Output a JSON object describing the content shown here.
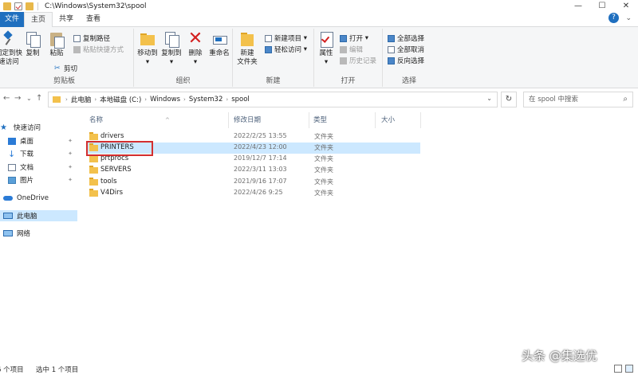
{
  "window": {
    "title": "C:\\Windows\\System32\\spool",
    "minimize": "—",
    "maximize": "☐",
    "close": "✕"
  },
  "ribbon_tabs": [
    "文件",
    "主页",
    "共享",
    "查看"
  ],
  "ribbon": {
    "clipboard": {
      "pin_label": "固定到快\n速访问",
      "copy_label": "复制",
      "paste_label": "粘贴",
      "copy_path": "复制路径",
      "paste_shortcut": "粘贴快捷方式",
      "cut": "剪切",
      "group_label": "剪贴板"
    },
    "organize": {
      "move_to": "移动到",
      "copy_to": "复制到",
      "delete": "删除",
      "rename": "重命名",
      "group_label": "组织"
    },
    "new": {
      "new_folder": "新建\n文件夹",
      "new_item": "新建项目",
      "easy_access": "轻松访问",
      "group_label": "新建"
    },
    "open": {
      "properties": "属性",
      "open": "打开",
      "edit": "编辑",
      "history": "历史记录",
      "group_label": "打开"
    },
    "select": {
      "select_all": "全部选择",
      "select_none": "全部取消",
      "invert": "反向选择",
      "group_label": "选择"
    }
  },
  "address": {
    "crumbs": [
      "此电脑",
      "本地磁盘 (C:)",
      "Windows",
      "System32",
      "spool"
    ],
    "search_placeholder": "在 spool 中搜索"
  },
  "nav": {
    "quick_access": "快速访问",
    "desktop": "桌面",
    "downloads": "下载",
    "documents": "文档",
    "pictures": "图片",
    "onedrive": "OneDrive",
    "this_pc": "此电脑",
    "network": "网络"
  },
  "columns": {
    "name": "名称",
    "modified": "修改日期",
    "type": "类型",
    "size": "大小"
  },
  "files": [
    {
      "name": "drivers",
      "date": "2022/2/25 13:55",
      "type": "文件夹"
    },
    {
      "name": "PRINTERS",
      "date": "2022/4/23 12:00",
      "type": "文件夹"
    },
    {
      "name": "prtprocs",
      "date": "2019/12/7 17:14",
      "type": "文件夹"
    },
    {
      "name": "SERVERS",
      "date": "2022/3/11 13:03",
      "type": "文件夹"
    },
    {
      "name": "tools",
      "date": "2021/9/16 17:07",
      "type": "文件夹"
    },
    {
      "name": "V4Dirs",
      "date": "2022/4/26 9:25",
      "type": "文件夹"
    }
  ],
  "status": {
    "item_count": "6 个项目",
    "selected": "选中 1 个项目"
  },
  "watermark": "头条 @集选优",
  "colors": {
    "accent": "#1f6fbf",
    "selection": "#cce8ff",
    "folder": "#f3c14c",
    "highlight_border": "#d32f2f"
  }
}
